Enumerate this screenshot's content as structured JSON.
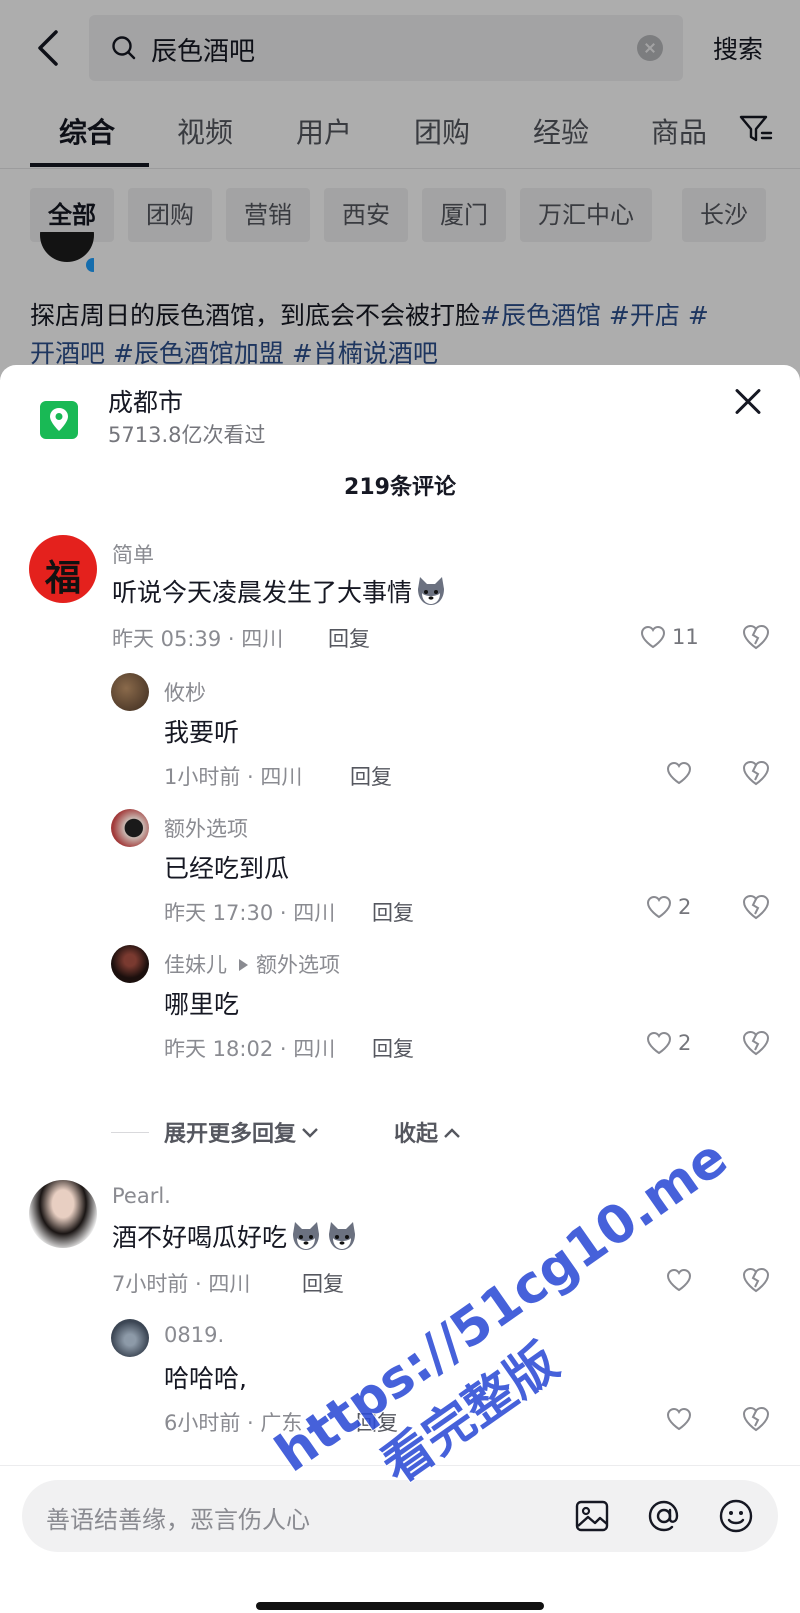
{
  "search": {
    "query": "辰色酒吧",
    "button": "搜索"
  },
  "tabs": [
    "综合",
    "视频",
    "用户",
    "团购",
    "经验",
    "商品"
  ],
  "chips": [
    "全部",
    "团购",
    "营销",
    "西安",
    "厦门",
    "万汇中心",
    "长沙"
  ],
  "post": {
    "text_plain": "探店周日的辰色酒馆，到底会不会被打脸",
    "tag1": "#辰色酒馆",
    "tag2": "#开店",
    "tag3_a": "#",
    "tag3_b": "开酒吧",
    "tag4": "#辰色酒馆加盟",
    "tag5": "#肖楠说酒吧"
  },
  "sheet": {
    "location": "成都市",
    "views": "5713.8亿次看过",
    "comment_count": "219条评论"
  },
  "comments": [
    {
      "name": "简单",
      "text": "听说今天凌晨发生了大事情",
      "time": "昨天 05:39 · 四川",
      "reply": "回复",
      "likes": "11"
    },
    {
      "name": "攸杪",
      "text": "我要听",
      "time": "1小时前 · 四川",
      "reply": "回复",
      "likes": ""
    },
    {
      "name": "额外选项",
      "text": "已经吃到瓜",
      "time": "昨天 17:30 · 四川",
      "reply": "回复",
      "likes": "2"
    },
    {
      "name": "佳妹儿",
      "reply_to": "额外选项",
      "text": "哪里吃",
      "time": "昨天 18:02 · 四川",
      "reply": "回复",
      "likes": "2"
    },
    {
      "name": "Pearl.",
      "text": "酒不好喝瓜好吃",
      "time": "7小时前 · 四川",
      "reply": "回复",
      "likes": ""
    },
    {
      "name": "0819.",
      "text": "哈哈哈,",
      "time": "6小时前 · 广东",
      "reply": "回复",
      "likes": ""
    }
  ],
  "expand": {
    "more": "展开更多回复",
    "collapse": "收起"
  },
  "input": {
    "placeholder": "善语结善缘，恶言伤人心"
  },
  "watermark": {
    "line1": "https://51cg10.me",
    "line2": "看完整版"
  },
  "avatar_badge": "福",
  "icons": [
    "back-arrow-icon",
    "search-icon",
    "clear-icon",
    "filter-icon",
    "location-pin-icon",
    "close-icon",
    "heart-icon",
    "dislike-heart-icon",
    "chevron-down-icon",
    "chevron-up-icon",
    "image-icon",
    "at-icon",
    "emoji-icon"
  ],
  "colors": {
    "accent_location": "#19b955",
    "hashtag": "#2b4e8c",
    "watermark": "#2d4cd6"
  }
}
